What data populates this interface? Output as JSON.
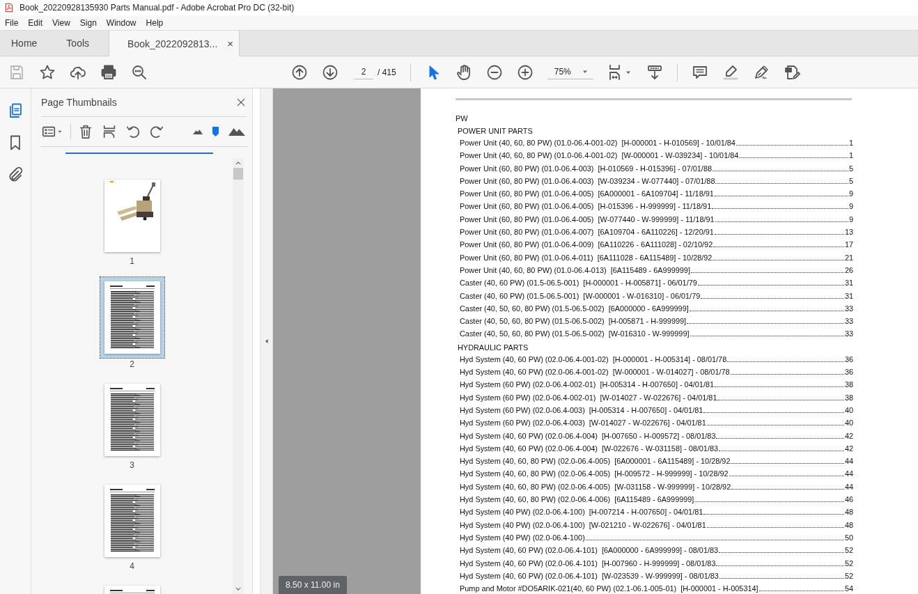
{
  "window": {
    "title": "Book_20220928135930 Parts Manual.pdf - Adobe Acrobat Pro DC (32-bit)"
  },
  "menu": [
    "File",
    "Edit",
    "View",
    "Sign",
    "Window",
    "Help"
  ],
  "tabs": [
    {
      "label": "Home",
      "selected": false
    },
    {
      "label": "Tools",
      "selected": false
    },
    {
      "label": "Book_2022092813...",
      "selected": true,
      "close": "×"
    }
  ],
  "toolbar": {
    "page_current": "2",
    "page_total": "/ 415",
    "zoom": "75%"
  },
  "side_rail": [
    {
      "kind": "pages",
      "selected": true
    },
    {
      "kind": "bookmarks",
      "selected": false
    },
    {
      "kind": "attachments",
      "selected": false
    }
  ],
  "thumbnails_panel": {
    "title": "Page Thumbnails",
    "pages": [
      {
        "label": "1",
        "kind": "picture",
        "selected": false
      },
      {
        "label": "2",
        "kind": "text",
        "selected": true
      },
      {
        "label": "3",
        "kind": "text",
        "selected": false
      },
      {
        "label": "4",
        "kind": "text",
        "selected": false
      },
      {
        "kind": "text",
        "selected": false
      }
    ]
  },
  "page_size": "8.50 x 11.00 in",
  "document": {
    "heading": "PW",
    "sections": [
      {
        "title": "POWER UNIT PARTS",
        "entries": [
          {
            "text": "Power Unit (40, 60, 80 PW) (01.0-06.4-001-02)  [H-000001 - H-010569] - 10/01/84",
            "page": "1"
          },
          {
            "text": "Power Unit (40, 60, 80 PW) (01.0-06.4-001-02)  [W-000001 - W-039234] - 10/01/84",
            "page": "1"
          },
          {
            "text": "Power Unit (60, 80 PW) (01.0-06.4-003)  [H-010569 - H-015396] - 07/01/88",
            "page": "5"
          },
          {
            "text": "Power Unit (60, 80 PW) (01.0-06.4-003)  [W-039234 - W-077440] - 07/01/88",
            "page": "5"
          },
          {
            "text": "Power Unit (60, 80 PW) (01.0-06.4-005)  [6A000001 - 6A109704] - 11/18/91",
            "page": "9"
          },
          {
            "text": "Power Unit (60, 80 PW) (01.0-06.4-005)  [H-015396 - H-999999] - 11/18/91",
            "page": "9"
          },
          {
            "text": "Power Unit (60, 80 PW) (01.0-06.4-005)  [W-077440 - W-999999] - 11/18/91",
            "page": "9"
          },
          {
            "text": "Power Unit (60, 80 PW) (01.0-06.4-007)  [6A109704 - 6A110226] - 12/20/91",
            "page": "13"
          },
          {
            "text": "Power Unit (60, 80 PW) (01.0-06.4-009)  [6A110226 - 6A111028] - 02/10/92",
            "page": "17"
          },
          {
            "text": "Power Unit (60, 80 PW) (01.0-06.4-011)  [6A111028 - 6A115489] - 10/28/92",
            "page": "21"
          },
          {
            "text": "Power Unit (40, 60, 80 PW) (01.0-06.4-013)  [6A115489 - 6A999999]",
            "page": "26"
          },
          {
            "text": "Caster (40, 60 PW) (01.5-06.5-001)  [H-000001 - H-005871] - 06/01/79",
            "page": "31"
          },
          {
            "text": "Caster (40, 60 PW) (01.5-06.5-001)  [W-000001 - W-016310] - 06/01/79",
            "page": "31"
          },
          {
            "text": "Caster (40, 50, 60, 80 PW) (01.5-06.5-002)  [6A000000 - 6A999999]",
            "page": "33"
          },
          {
            "text": "Caster (40, 50, 60, 80 PW) (01.5-06.5-002)  [H-005871 - H-999999]",
            "page": "33"
          },
          {
            "text": "Caster (40, 50, 60, 80 PW) (01.5-06.5-002)  [W-016310 - W-999999]",
            "page": "33"
          }
        ]
      },
      {
        "title": "HYDRAULIC PARTS",
        "entries": [
          {
            "text": "Hyd System (40, 60 PW) (02.0-06.4-001-02)  [H-000001 - H-005314] - 08/01/78",
            "page": "36"
          },
          {
            "text": "Hyd System (40, 60 PW) (02.0-06.4-001-02)  [W-000001 - W-014027] - 08/01/78",
            "page": "36"
          },
          {
            "text": "Hyd System (60 PW) (02.0-06.4-002-01)  [H-005314 - H-007650] - 04/01/81",
            "page": "38"
          },
          {
            "text": "Hyd System (60 PW) (02.0-06.4-002-01)  [W-014027 - W-022676] - 04/01/81",
            "page": "38"
          },
          {
            "text": "Hyd System (60 PW) (02.0-06.4-003)  [H-005314 - H-007650] - 04/01/81",
            "page": "40"
          },
          {
            "text": "Hyd System (60 PW) (02.0-06.4-003)  [W-014027 - W-022676] - 04/01/81",
            "page": "40"
          },
          {
            "text": "Hyd System (40, 60 PW) (02.0-06.4-004)  [H-007650 - H-009572] - 08/01/83",
            "page": "42"
          },
          {
            "text": "Hyd System (40, 60 PW) (02.0-06.4-004)  [W-022676 - W-031158] - 08/01/83",
            "page": "42"
          },
          {
            "text": "Hyd System (40, 60, 80 PW) (02.0-06.4-005)  [6A000001 - 6A115489] - 10/28/92",
            "page": "44"
          },
          {
            "text": "Hyd System (40, 60, 80 PW) (02.0-06.4-005)  [H-009572 - H-999999] - 10/28/92",
            "page": "44"
          },
          {
            "text": "Hyd System (40, 60, 80 PW) (02.0-06.4-005)  [W-031158 - W-999999] - 10/28/92",
            "page": "44"
          },
          {
            "text": "Hyd System (40, 60, 80 PW) (02.0-06.4-006)  [6A115489 - 6A999999]",
            "page": "46"
          },
          {
            "text": "Hyd System (40 PW) (02.0-06.4-100)  [H-007214 - H-007650] - 04/01/81",
            "page": "48"
          },
          {
            "text": "Hyd System (40 PW) (02.0-06.4-100)  [W-021210 - W-022676] - 04/01/81",
            "page": "48"
          },
          {
            "text": "Hyd System (40 PW) (02.0-06.4-100)",
            "page": "50"
          },
          {
            "text": "Hyd System (40, 60 PW) (02.0-06.4-101)  [6A000000 - 6A999999] - 08/01/83",
            "page": "52"
          },
          {
            "text": "Hyd System (40, 60 PW) (02.0-06.4-101)  [H-007960 - H-999999] - 08/01/83",
            "page": "52"
          },
          {
            "text": "Hyd System (40, 60 PW) (02.0-06.4-101)  [W-023539 - W-999999] - 08/01/83",
            "page": "52"
          },
          {
            "text": "Pump and Motor #DO5ARIK-021(40, 60 PW) (02.1-06.1-005-01)  [H-000001 - H-005314]",
            "page": "54"
          }
        ]
      }
    ]
  }
}
